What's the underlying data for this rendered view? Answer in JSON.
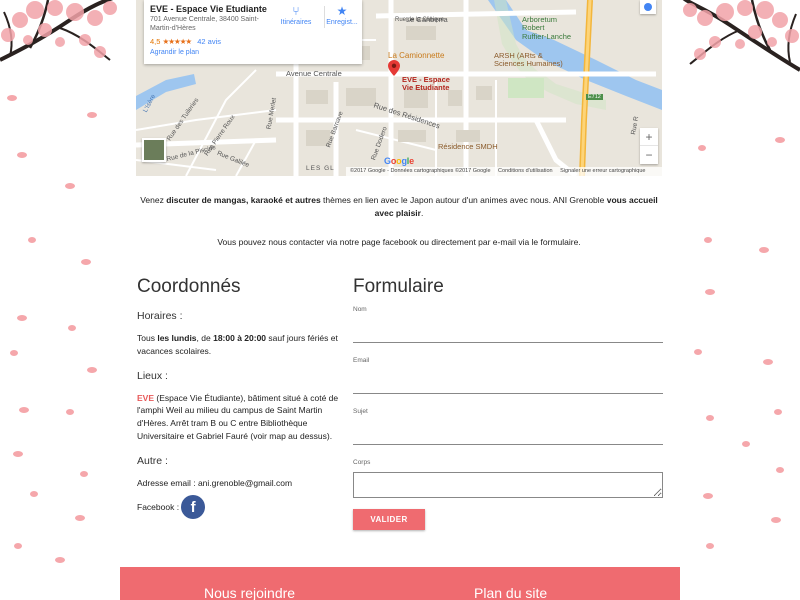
{
  "map": {
    "place_name": "EVE - Espace Vie Etudiante",
    "place_address": "701 Avenue Centrale, 38400 Saint-Martin-d'Hères",
    "rating_value": "4,5",
    "rating_stars": "★★★★★",
    "rating_reviews": "42 avis",
    "enlarge_link": "Agrandir le plan",
    "directions_label": "Itinéraires",
    "save_label": "Enregist...",
    "zoom_in": "+",
    "zoom_out": "−",
    "google_logo": "Google",
    "footer": {
      "data": "©2017 Google - Données cartographiques ©2017 Google",
      "terms": "Conditions d'utilisation",
      "report": "Signaler une erreur cartographique"
    },
    "labels": {
      "le_canberra": "Le Canberra",
      "rue_clinique": "Rue de la Clinique",
      "arboretum": "Arboretum\nRobert\nRuffier-Lanche",
      "la_camionnette": "La Camionnette",
      "arsh": "ARSH (ARts &\nSciences Humaines)",
      "eve_pin": "EVE - Espace\nVie Etudiante",
      "avenue_centrale": "Avenue Centrale",
      "rue_residences": "Rue des Résidences",
      "residence_smdh": "Résidence SMDH",
      "rue_piscine": "Rue de la Piscine",
      "rue_barnave": "Rue Barnave",
      "rue_dodero": "Rue Dodero",
      "rue_galilee": "Rue Galilée",
      "rue_roux": "Rue Pierre Roux",
      "rue_tuileries": "Rue des Tuileries",
      "rue_merlet": "Rue Merlet",
      "rue_isere": "L'Isère",
      "les_gl": "LES GL",
      "rue_r": "Rue R",
      "e712": "E712"
    }
  },
  "intro": {
    "part1": "Venez ",
    "bold1": "discuter de mangas, karaoké et autres",
    "part2": " thèmes en lien avec le Japon autour d'un animes avec nous. ANI Grenoble ",
    "bold2": "vous accueil avec plaisir",
    "part3": "."
  },
  "contact_line": "Vous pouvez nous contacter via notre page facebook ou directement par e-mail via le formulaire.",
  "coord": {
    "title": "Coordonnés",
    "horaires_title": "Horaires :",
    "horaires_p1": "Tous ",
    "horaires_b1": "les lundis",
    "horaires_p2": ", de ",
    "horaires_b2": "18:00 à 20:00",
    "horaires_p3": " sauf jours fériés et vacances scolaires.",
    "lieux_title": "Lieux :",
    "lieux_eve": "EVE",
    "lieux_text": " (Espace Vie Étudiante), bâtiment situé à coté de l'amphi Weil au milieu du campus de Saint Martin d'Hères. Arrêt tram B ou C entre Bibliothèque Universitaire et Gabriel Fauré (voir map au dessus).",
    "autre_title": "Autre :",
    "email_line": "Adresse email : ani.grenoble@gmail.com",
    "facebook_label": "Facebook :",
    "facebook_glyph": "f"
  },
  "form": {
    "title": "Formulaire",
    "nom_label": "Nom",
    "email_label": "Email",
    "sujet_label": "Sujet",
    "corps_label": "Corps",
    "submit_label": "VALIDER"
  },
  "footer": {
    "join": "Nous rejoindre",
    "sitemap": "Plan du site"
  },
  "colors": {
    "accent": "#ef6b70",
    "facebook": "#3b5998",
    "petal": "#f4a6a8"
  }
}
